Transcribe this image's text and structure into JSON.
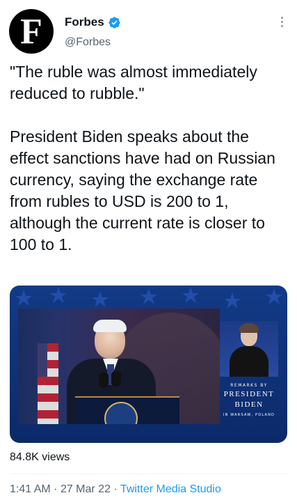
{
  "account": {
    "avatar_letter": "F",
    "name": "Forbes",
    "handle": "@Forbes",
    "verified": true,
    "verified_color": "#1d9bf0"
  },
  "icons": {
    "verified": "verified-badge-icon",
    "more": "more-vertical-icon"
  },
  "tweet": {
    "text": "\"The ruble was almost immediately reduced to rubble.\"\n\nPresident Biden speaks about the effect sanctions have had on Russian currency, saying the exchange rate from rubles to USD is 200 to 1, although the current rate is closer to 100 to 1."
  },
  "media": {
    "caption_remarks": "REMARKS BY",
    "caption_name_line1": "PRESIDENT",
    "caption_name_line2": "BIDEN",
    "caption_location": "IN WARSAW, POLAND",
    "background_color": "#123a86"
  },
  "stats": {
    "views": "84.8K views"
  },
  "meta": {
    "time": "1:41 AM",
    "separator": "·",
    "date": "27 Mar 22",
    "source": "Twitter Media Studio",
    "link_color": "#1d9bf0"
  }
}
